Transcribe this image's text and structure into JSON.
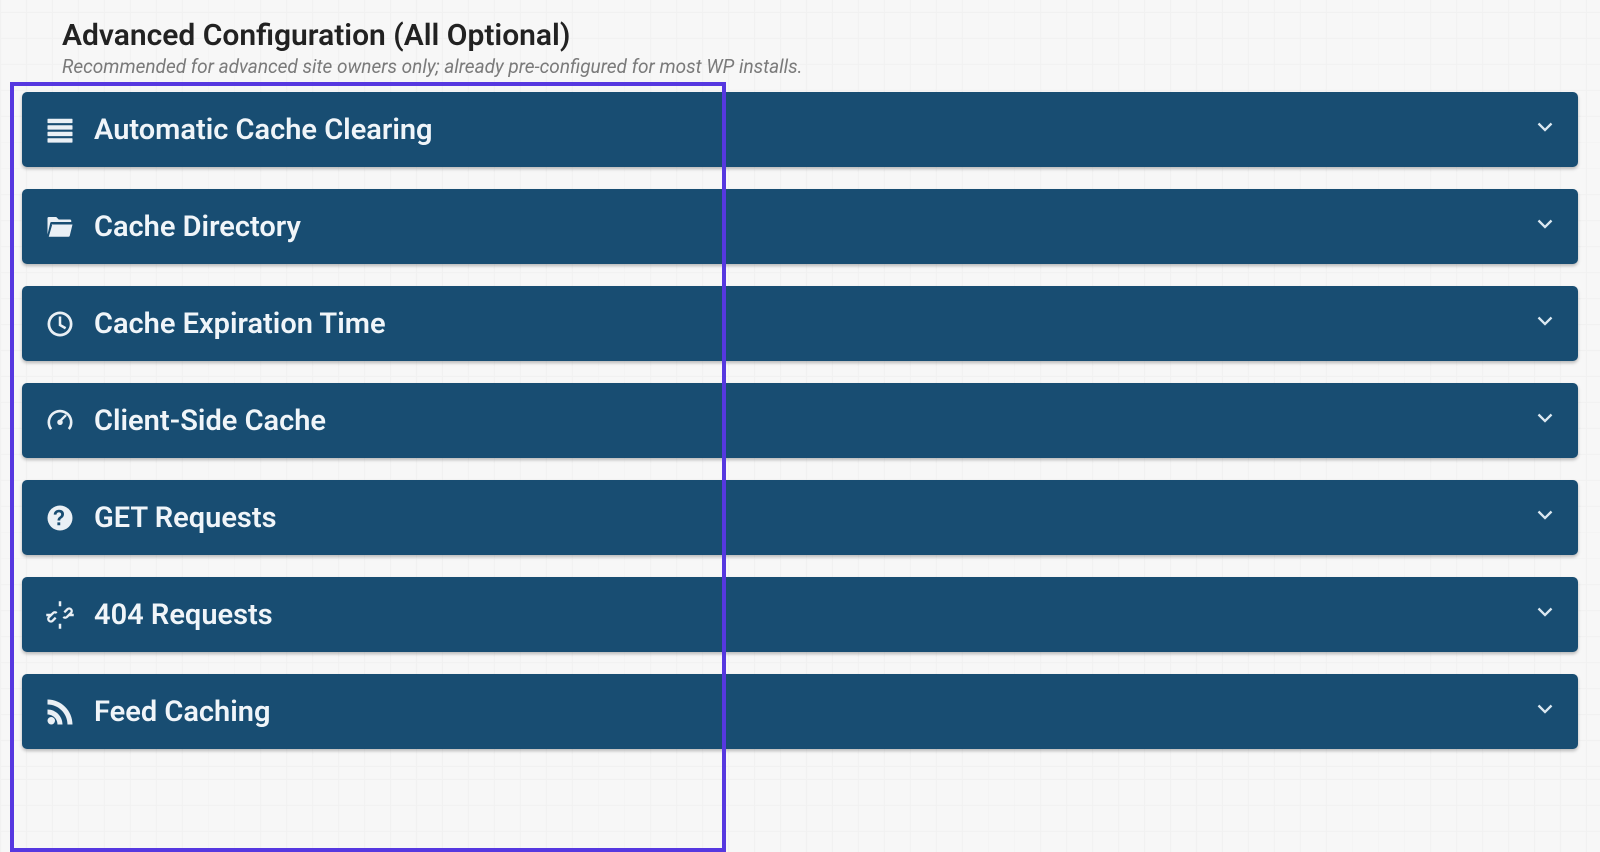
{
  "header": {
    "title": "Advanced Configuration (All Optional)",
    "subtitle": "Recommended for advanced site owners only; already pre-configured for most WP installs."
  },
  "panels": [
    {
      "label": "Automatic Cache Clearing",
      "icon": "server-stack-icon"
    },
    {
      "label": "Cache Directory",
      "icon": "folder-open-icon"
    },
    {
      "label": "Cache Expiration Time",
      "icon": "clock-icon"
    },
    {
      "label": "Client-Side Cache",
      "icon": "gauge-icon"
    },
    {
      "label": "GET Requests",
      "icon": "question-circle-icon"
    },
    {
      "label": "404 Requests",
      "icon": "broken-link-icon"
    },
    {
      "label": "Feed Caching",
      "icon": "rss-icon"
    }
  ],
  "colors": {
    "panel_bg": "#184d72",
    "panel_text": "#eef4f8",
    "highlight_border": "#5638e0"
  }
}
